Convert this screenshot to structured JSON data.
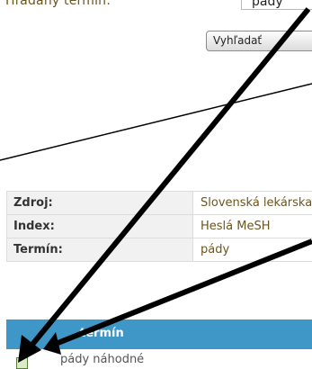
{
  "search": {
    "label": "Hľadaný termín:",
    "value": "pády",
    "button_label": "Vyhľadať"
  },
  "info_rows": [
    {
      "key": "Zdroj:",
      "value": "Slovenská lekárska"
    },
    {
      "key": "Index:",
      "value": "Heslá MeSH"
    },
    {
      "key": "Termín:",
      "value": "pády"
    }
  ],
  "results": {
    "column_header": "termín",
    "rows": [
      {
        "term": "pády náhodné"
      }
    ]
  },
  "colors": {
    "header_blue": "#3f97c7",
    "label_brown": "#6b5520",
    "annotation_black": "#000000"
  }
}
